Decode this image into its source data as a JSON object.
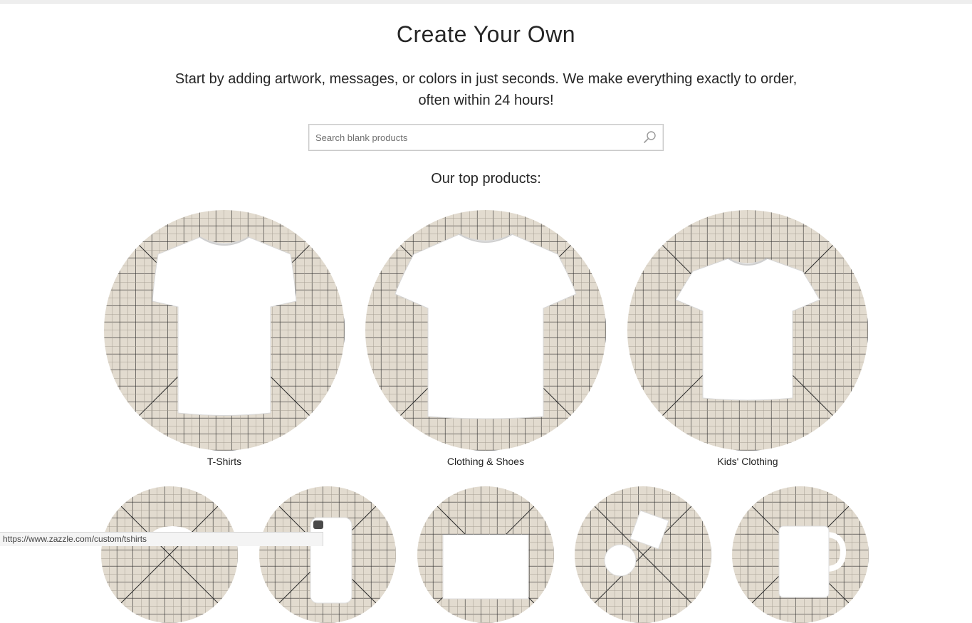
{
  "header": {
    "title": "Create Your Own",
    "subtitle": "Start by adding artwork, messages, or colors in just seconds. We make everything exactly to order, often within 24 hours!"
  },
  "search": {
    "placeholder": "Search blank products",
    "value": ""
  },
  "top_products": {
    "heading": "Our top products:",
    "items": [
      {
        "label": "T-Shirts",
        "image": "white-womens-tshirt"
      },
      {
        "label": "Clothing & Shoes",
        "image": "white-tshirt"
      },
      {
        "label": "Kids' Clothing",
        "image": "white-kids-tshirt"
      }
    ],
    "more_items": [
      {
        "image": "white-product"
      },
      {
        "image": "white-phone-case"
      },
      {
        "image": "white-cards"
      },
      {
        "image": "white-coaster"
      },
      {
        "image": "white-mug"
      }
    ]
  },
  "status_bar": {
    "url": "https://www.zazzle.com/custom/tshirts"
  },
  "colors": {
    "background": "#ffffff",
    "mat_base": "#e3dcd0",
    "grid_line": "#2b2b2b",
    "shirt": "#ffffff"
  }
}
